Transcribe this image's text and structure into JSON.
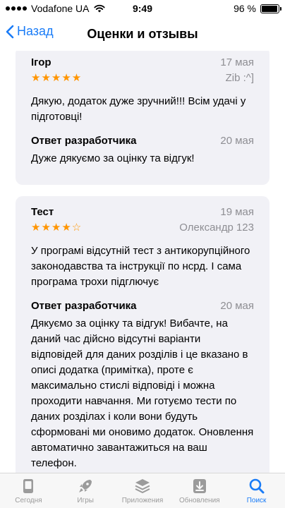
{
  "status": {
    "carrier": "Vodafone UA",
    "time": "9:49",
    "battery": "96 %",
    "battery_level": 0.96
  },
  "nav": {
    "back_label": "Назад",
    "title": "Оценки и отзывы"
  },
  "reviews": [
    {
      "title": "Ігор",
      "date": "17 мая",
      "rating": 5,
      "author": "Zib :^]",
      "text": "Дякую, додаток дуже зручний!!! Всім удачі у підготовці!",
      "dev_label": "Ответ разработчика",
      "dev_date": "20 мая",
      "dev_text": "Дуже дякуємо за оцінку та відгук!"
    },
    {
      "title": "Тест",
      "date": "19 мая",
      "rating": 4,
      "author": "Олександр 123",
      "text": "У програмі відсутній тест з антикорупційного законодавства та інструкції по нсрд. І сама програма трохи підглючує",
      "dev_label": "Ответ разработчика",
      "dev_date": "20 мая",
      "dev_text": "Дякуємо за оцінку та відгук! Вибачте, на даний час дійсно відсутні варіанти відповідей для даних розділів і це вказано в описі додатка (примітка), проте є максимально стислі відповіді і можна проходити навчання. Ми готуємо тести по даних розділах і коли вони будуть сформовані ми оновимо додаток. Оновлення автоматично завантажиться на ваш телефон."
    }
  ],
  "tabs": [
    {
      "label": "Сегодня",
      "icon": "today-icon",
      "active": false
    },
    {
      "label": "Игры",
      "icon": "rocket-icon",
      "active": false
    },
    {
      "label": "Приложения",
      "icon": "layers-icon",
      "active": false
    },
    {
      "label": "Обновления",
      "icon": "download-icon",
      "active": false
    },
    {
      "label": "Поиск",
      "icon": "search-icon",
      "active": true
    }
  ],
  "colors": {
    "accent": "#1a7cf7",
    "star": "#ff9500",
    "card_bg": "#f1f1f6",
    "muted": "#8e8e93"
  }
}
